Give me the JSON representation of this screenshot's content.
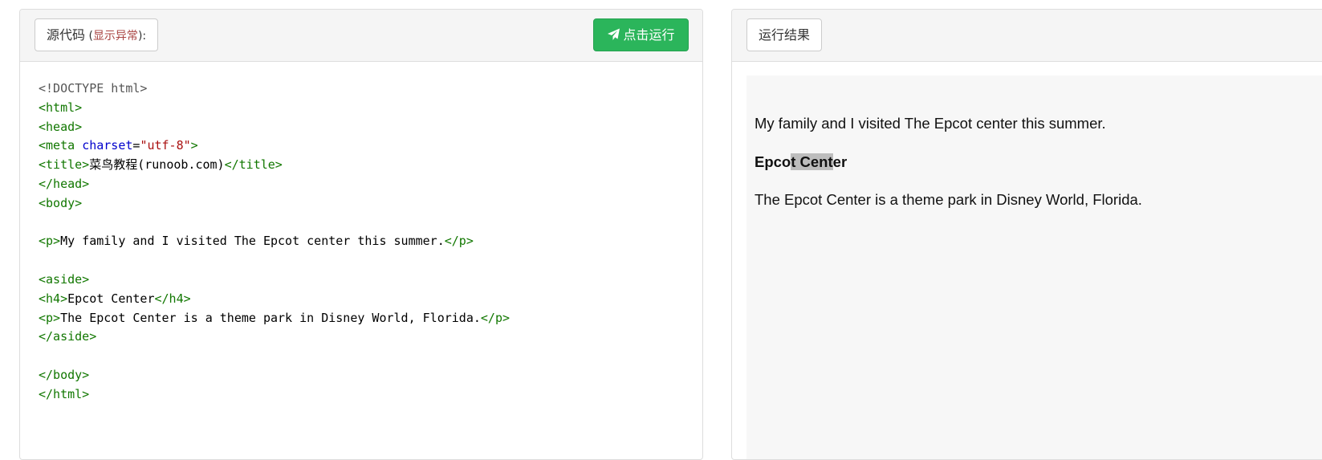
{
  "left_panel": {
    "label_prefix": "源代码",
    "label_open": " (",
    "label_warning": "显示异常",
    "label_close": "):",
    "run_button": "点击运行",
    "code_lines": [
      [
        {
          "c": "meta",
          "t": "<!DOCTYPE html>"
        }
      ],
      [
        {
          "c": "tag",
          "t": "<html>"
        }
      ],
      [
        {
          "c": "tag",
          "t": "<head>"
        }
      ],
      [
        {
          "c": "tag",
          "t": "<meta "
        },
        {
          "c": "attr",
          "t": "charset"
        },
        {
          "c": "",
          "t": "="
        },
        {
          "c": "str",
          "t": "\"utf-8\""
        },
        {
          "c": "tag",
          "t": ">"
        }
      ],
      [
        {
          "c": "tag",
          "t": "<title>"
        },
        {
          "c": "",
          "t": "菜鸟教程(runoob.com)"
        },
        {
          "c": "tag",
          "t": "</title>"
        }
      ],
      [
        {
          "c": "tag",
          "t": "</head>"
        }
      ],
      [
        {
          "c": "tag",
          "t": "<body>"
        }
      ],
      [],
      [
        {
          "c": "tag",
          "t": "<p>"
        },
        {
          "c": "",
          "t": "My family and I visited The Epcot center this summer."
        },
        {
          "c": "tag",
          "t": "</p>"
        }
      ],
      [],
      [
        {
          "c": "tag",
          "t": "<aside>"
        }
      ],
      [
        {
          "c": "tag",
          "t": "<h4>"
        },
        {
          "c": "",
          "t": "Epcot Center"
        },
        {
          "c": "tag",
          "t": "</h4>"
        }
      ],
      [
        {
          "c": "tag",
          "t": "<p>"
        },
        {
          "c": "",
          "t": "The Epcot Center is a theme park in Disney World, Florida."
        },
        {
          "c": "tag",
          "t": "</p>"
        }
      ],
      [
        {
          "c": "tag",
          "t": "</aside>"
        }
      ],
      [],
      [
        {
          "c": "tag",
          "t": "</body>"
        }
      ],
      [
        {
          "c": "tag",
          "t": "</html>"
        }
      ]
    ]
  },
  "right_panel": {
    "label": "运行结果",
    "result": {
      "paragraph1": "My family and I visited The Epcot center this summer.",
      "heading_before": "Epco",
      "heading_highlight": "t Cent",
      "heading_after": "er",
      "paragraph2": "The Epcot Center is a theme park in Disney World, Florida."
    }
  },
  "colors": {
    "run_button_bg": "#2bb55b",
    "warning_text": "#a94442",
    "code_tag": "#117700",
    "code_attr": "#0000cc",
    "code_string": "#aa1111",
    "result_bg": "#f7f7f7",
    "selection_highlight": "#bdbdbd"
  },
  "icons": {
    "run_button_icon": "paper-plane-icon"
  }
}
